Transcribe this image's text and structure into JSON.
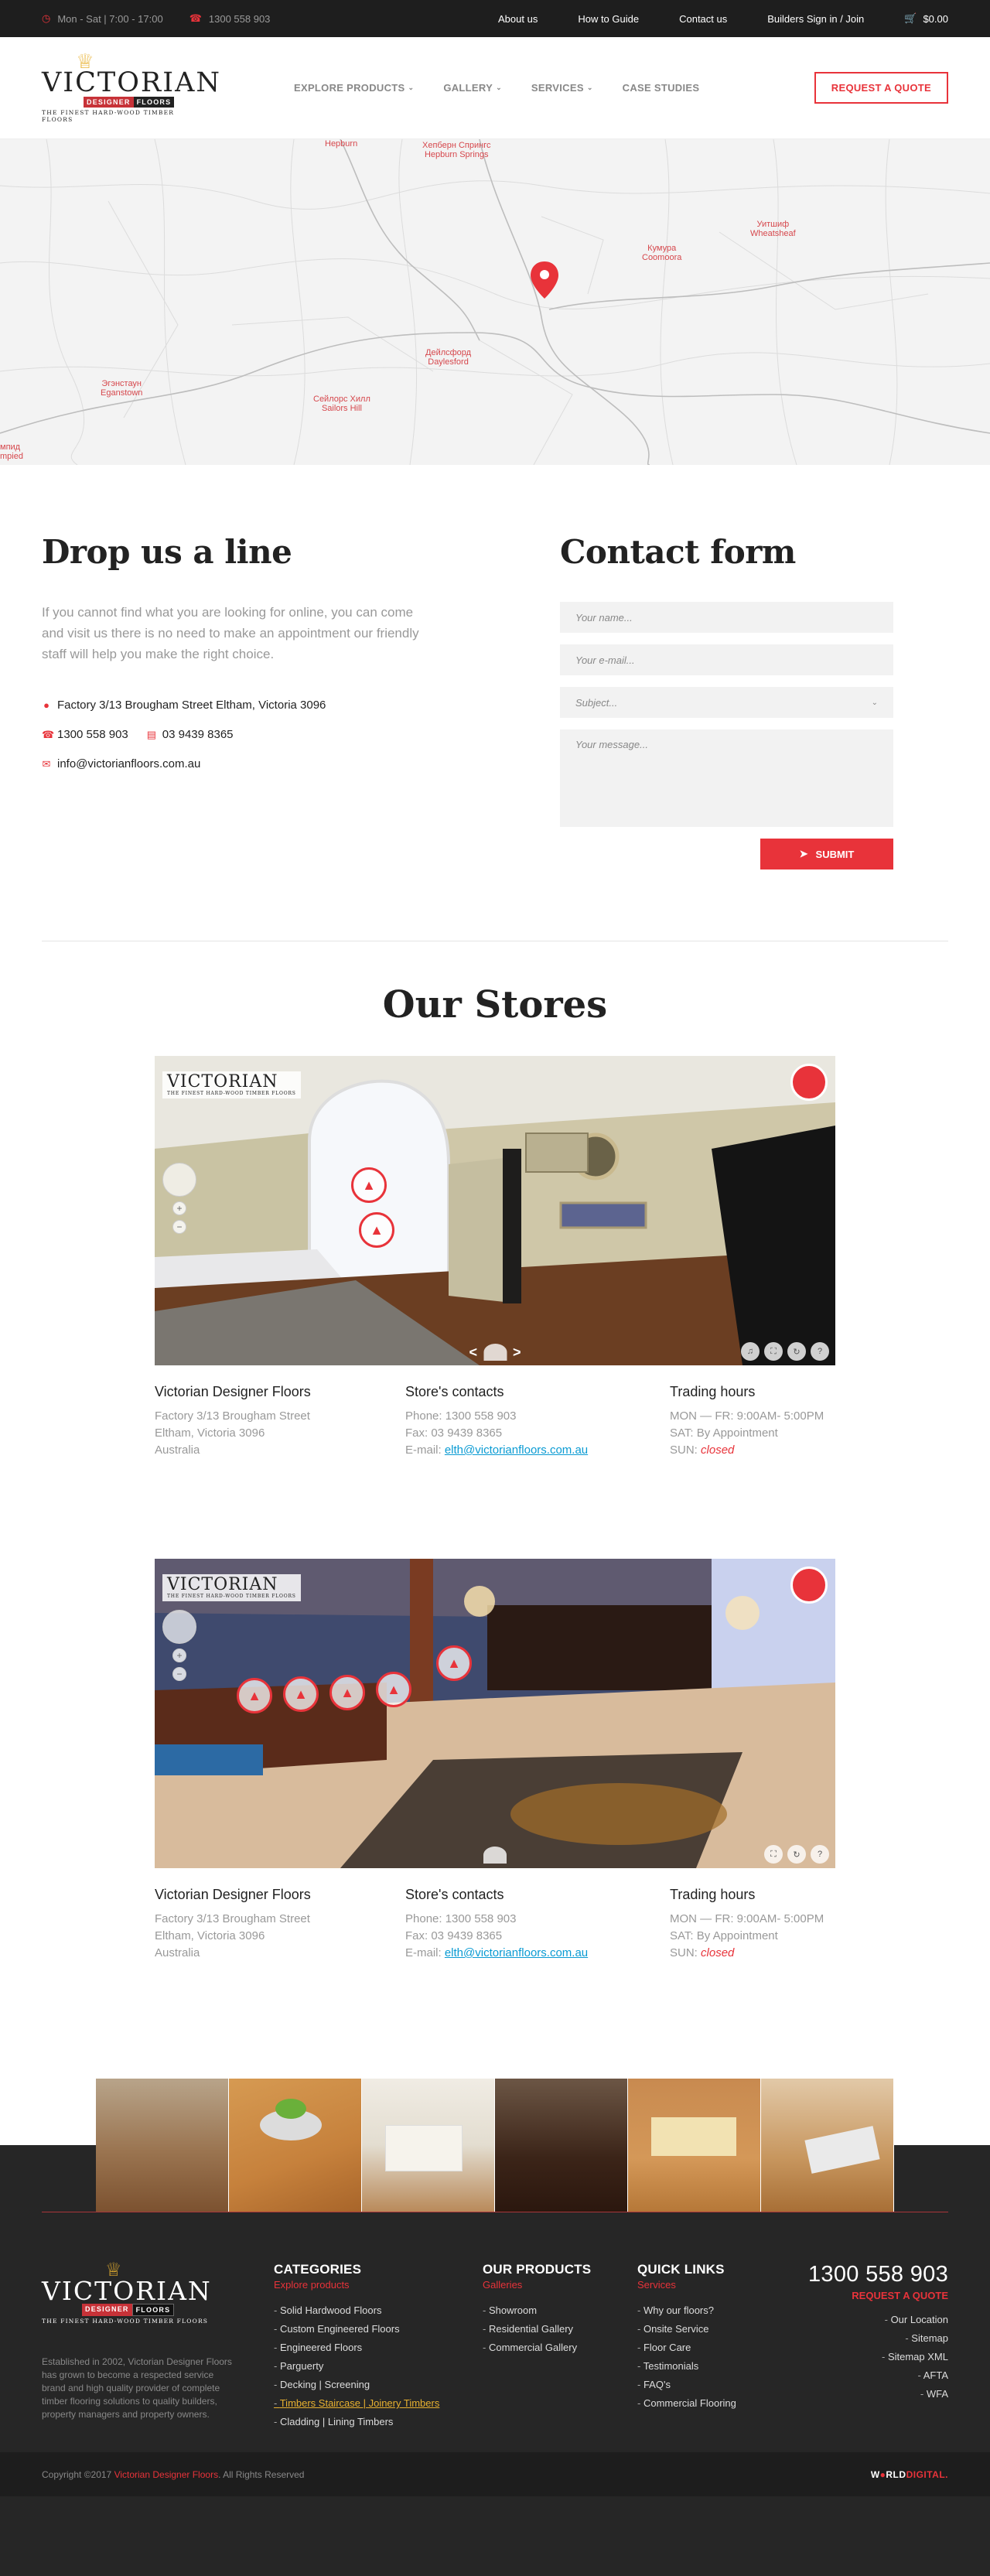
{
  "topbar": {
    "hours": "Mon - Sat | 7:00 - 17:00",
    "phone": "1300 558 903",
    "links": [
      "About us",
      "How to Guide",
      "Contact us",
      "Builders Sign in / Join"
    ],
    "cart_total": "$0.00"
  },
  "logo": {
    "wordmark": "VICTORIAN",
    "badge_left": "DESIGNER",
    "badge_right": "FLOORS",
    "tagline": "THE FINEST HARD-WOOD TIMBER FLOORS"
  },
  "nav": {
    "items": [
      {
        "label": "EXPLORE PRODUCTS",
        "has_dropdown": true
      },
      {
        "label": "GALLERY",
        "has_dropdown": true
      },
      {
        "label": "SERVICES",
        "has_dropdown": true
      },
      {
        "label": "CASE STUDIES",
        "has_dropdown": false
      }
    ],
    "quote_button": "REQUEST A QUOTE"
  },
  "map": {
    "places": [
      {
        "name": "Hepburn"
      },
      {
        "name": "Хепберн Спрингс\nHepburn Springs"
      },
      {
        "name": "Кумура\nCoomoora"
      },
      {
        "name": "Уитшиф\nWheatsheaf"
      },
      {
        "name": "Дейлсфорд\nDaylesford"
      },
      {
        "name": "Эгэнстаун\nEganstown"
      },
      {
        "name": "Сейлорс Хилл\nSailors Hill"
      },
      {
        "name": "мпид\nmpied"
      }
    ]
  },
  "contact": {
    "heading": "Drop us a line",
    "lede": "If you cannot find what you are looking for online, you can come and visit us there is no need to make an appointment our friendly staff will help you make the right choice.",
    "address": "Factory 3/13 Brougham Street Eltham, Victoria 3096",
    "phone": "1300 558 903",
    "fax": "03 9439 8365",
    "email": "info@victorianfloors.com.au"
  },
  "form": {
    "heading": "Contact form",
    "name_placeholder": "Your name...",
    "email_placeholder": "Your e-mail...",
    "subject_placeholder": "Subject...",
    "message_placeholder": "Your message...",
    "submit": "SUBMIT"
  },
  "stores": {
    "heading": "Our Stores",
    "list": [
      {
        "name": "Victorian Designer Floors",
        "address": [
          "Factory 3/13 Brougham Street",
          "Eltham, Victoria 3096",
          "Australia"
        ],
        "contacts_title": "Store's contacts",
        "phone": "Phone:  1300 558 903",
        "fax": "Fax: 03 9439 8365",
        "email_label": "E-mail: ",
        "email": "elth@victorianfloors.com.au",
        "hours_title": "Trading hours",
        "mon_fri": "MON — FR:  9:00AM- 5:00PM",
        "sat": "SAT:  By Appointment",
        "sun_label": "SUN:  ",
        "sun": "closed"
      },
      {
        "name": "Victorian Designer Floors",
        "address": [
          "Factory 3/13 Brougham Street",
          "Eltham, Victoria 3096",
          "Australia"
        ],
        "contacts_title": "Store's contacts",
        "phone": "Phone: 1300 558 903",
        "fax": "Fax: 03 9439 8365",
        "email_label": "E-mail: ",
        "email": "elth@victorianfloors.com.au",
        "hours_title": "Trading hours",
        "mon_fri": "MON — FR:  9:00AM- 5:00PM",
        "sat": "SAT:  By Appointment",
        "sun_label": "SUN:  ",
        "sun": "closed"
      }
    ]
  },
  "footer": {
    "about": "Established in 2002, Victorian Designer Floors has grown to become a respected service brand and high quality provider of complete timber flooring solutions to quality builders, property managers and property owners.",
    "categories": {
      "title": "CATEGORIES",
      "sub": "Explore products",
      "items": [
        "Solid Hardwood Floors",
        "Custom Engineered Floors",
        "Engineered Floors",
        "Parguerty",
        "Decking | Screening",
        "Timbers Staircase | Joinery Timbers",
        "Cladding | Lining Timbers"
      ]
    },
    "products": {
      "title": "OUR PRODUCTS",
      "sub": "Galleries",
      "items": [
        "Showroom",
        "Residential Gallery",
        "Commercial Gallery"
      ]
    },
    "quick": {
      "title": "QUICK LINKS",
      "sub": "Services",
      "items": [
        "Why our floors?",
        "Onsite Service",
        "Floor Care",
        "Testimonials",
        "FAQ's",
        "Commercial Flooring"
      ]
    },
    "phone": "1300 558 903",
    "quote": "REQUEST A QUOTE",
    "right_links": [
      "Our Location",
      "Sitemap",
      "Sitemap XML",
      "AFTA",
      "WFA"
    ],
    "copyright_prefix": "Copyright ©2017 ",
    "copyright_brand": "Victorian Designer Floors",
    "copyright_suffix": ". All Rights Reserved",
    "credit_a": "W",
    "credit_b": "RLD",
    "credit_c": "DIGITAL."
  },
  "colors": {
    "accent": "#e8333a",
    "dark": "#1e1e1e",
    "link": "#0a9bd3",
    "gold": "#e8b130"
  }
}
